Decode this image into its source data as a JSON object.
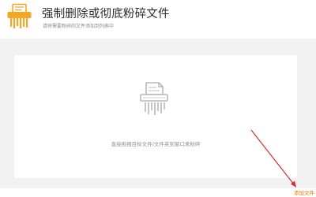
{
  "header": {
    "title": "强制删除或彻底粉碎文件",
    "subtitle": "请将需要粉碎的文件添加到列表中",
    "icon": "shredder-app-icon"
  },
  "drop_zone": {
    "icon": "shredder-icon",
    "hint": "直接拖拽目标文件/文件夹到窗口来粉碎"
  },
  "actions": {
    "add_file_label": "添加文件"
  },
  "annotation": {
    "arrow": "red-arrow",
    "color": "#d32f2f"
  },
  "colors": {
    "accent": "#f5a623",
    "link": "#e07b00",
    "panel": "#f2f2f2"
  }
}
